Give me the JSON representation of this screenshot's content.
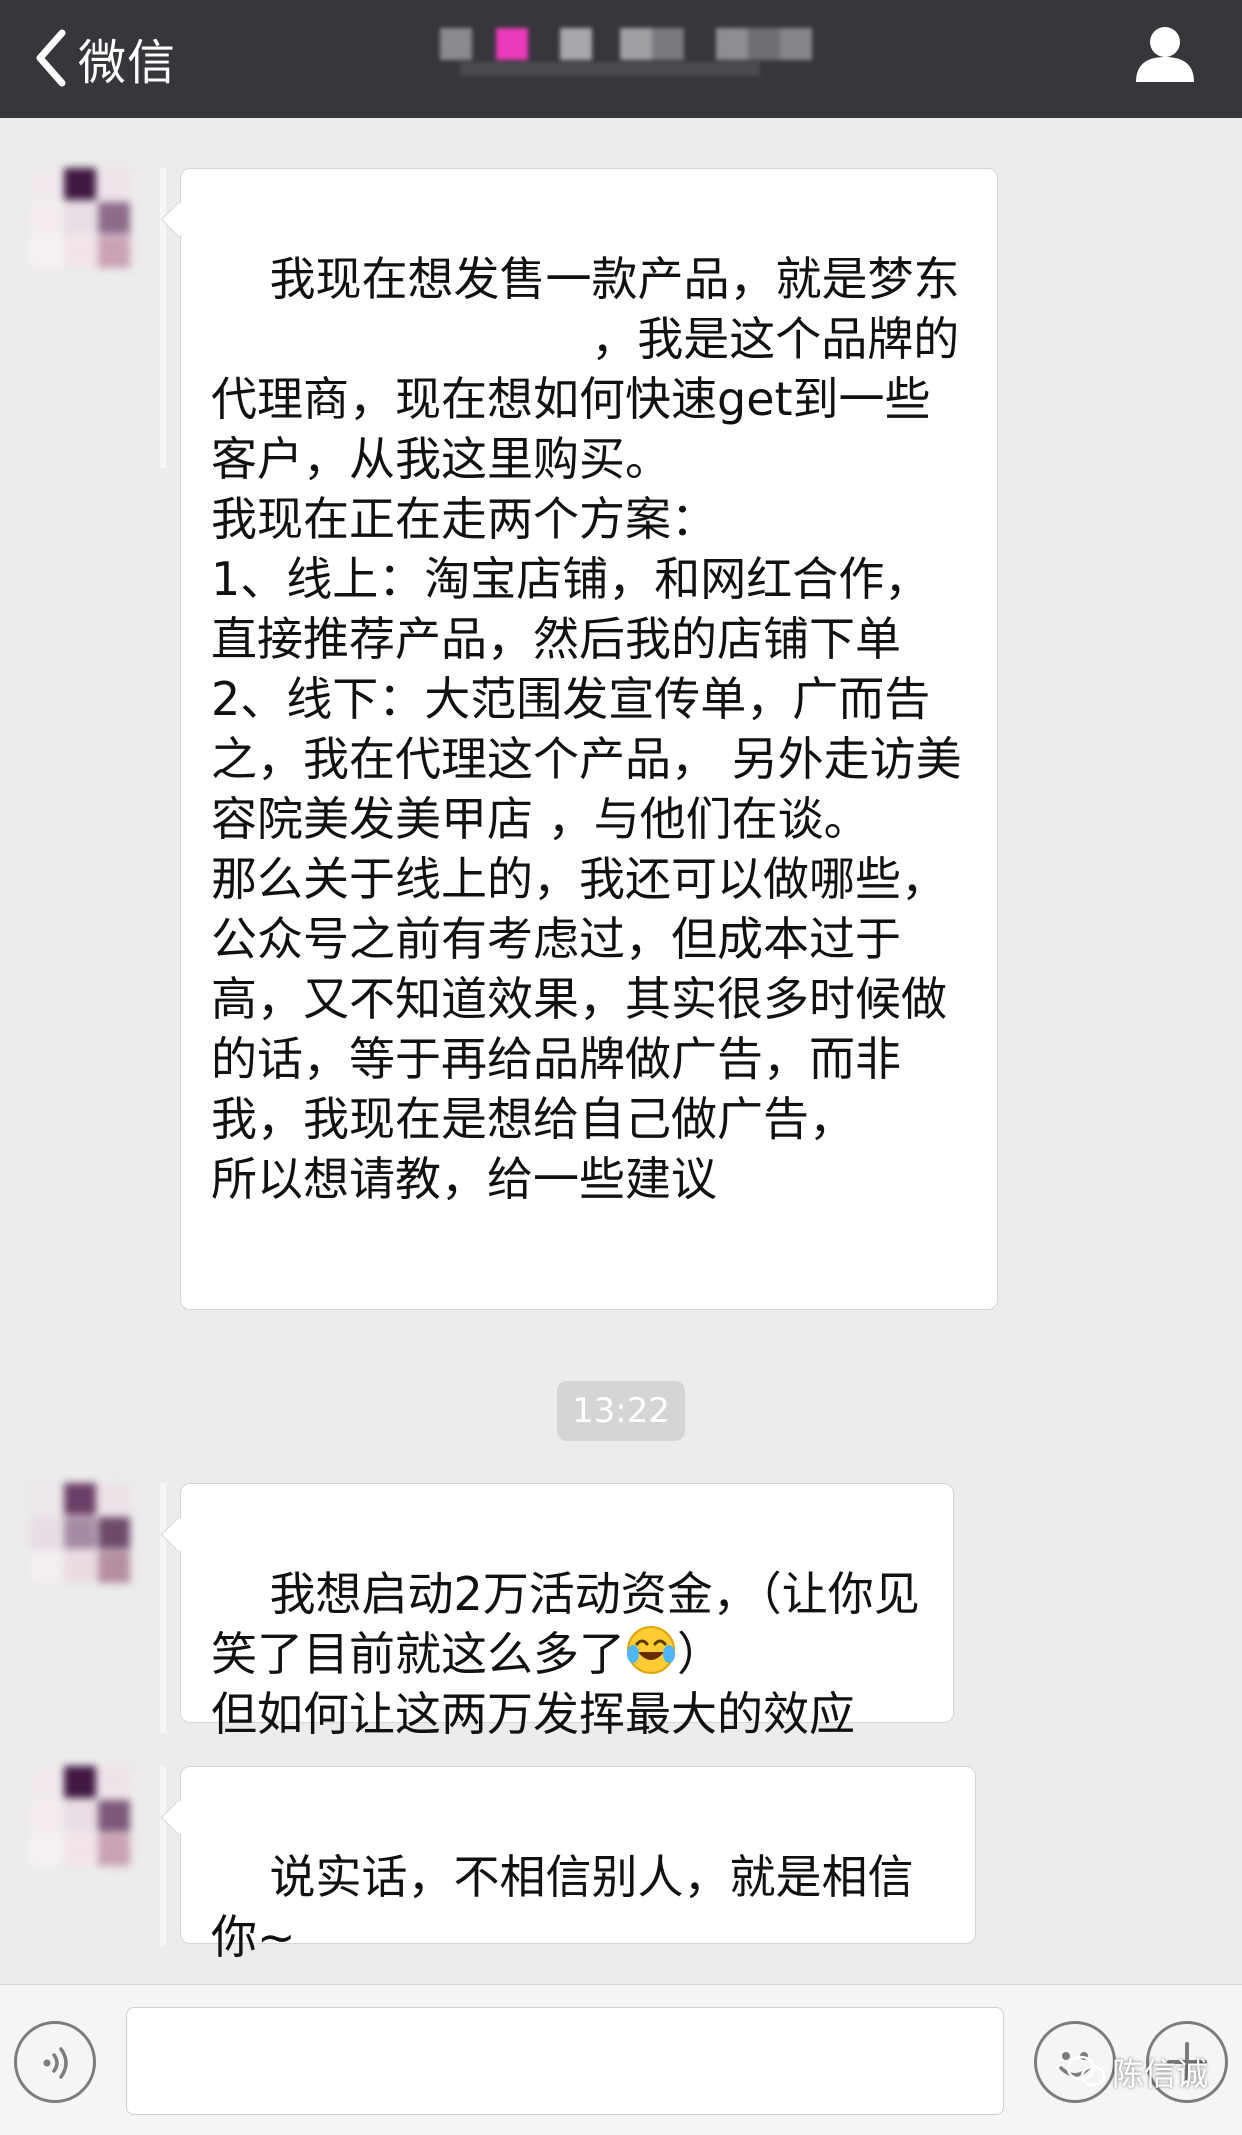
{
  "header": {
    "back_label": "微信",
    "title": "",
    "colors": {
      "bar": "#36363b",
      "title_blur_accent": "#e83ab9"
    }
  },
  "messages": [
    {
      "sender": "contact",
      "text": "我现在想发售一款产品，就是梦东\n                          ，我是这个品牌的代理商，现在想如何快速get到一些客户，从我这里购买。\n我现在正在走两个方案：\n1、线上：淘宝店铺，和网红合作，直接推荐产品，然后我的店铺下单\n2、线下：大范围发宣传单，广而告之，我在代理这个产品， 另外走访美容院美发美甲店 ，与他们在谈。\n那么关于线上的，我还可以做哪些，公众号之前有考虑过，但成本过于高，又不知道效果，其实很多时候做的话，等于再给品牌做广告，而非我，我现在是想给自己做广告，\n所以想请教，给一些建议"
    },
    {
      "sender": "contact",
      "text_before_emoji": "我想启动2万活动资金，（让你见笑了目前就这么多了",
      "emoji": "crying-laughing-emoji",
      "text_after_emoji": "）\n但如何让这两万发挥最大的效应"
    },
    {
      "sender": "contact",
      "text": "说实话，不相信别人，就是相信你~"
    }
  ],
  "timestamp": "13:22",
  "input": {
    "value": "",
    "placeholder": ""
  },
  "icons": {
    "back": "chevron-left-icon",
    "profile": "person-icon",
    "voice": "voice-icon",
    "emoji": "emoji-face-icon",
    "plus": "plus-icon"
  },
  "watermark": {
    "label": "陈信诚"
  }
}
